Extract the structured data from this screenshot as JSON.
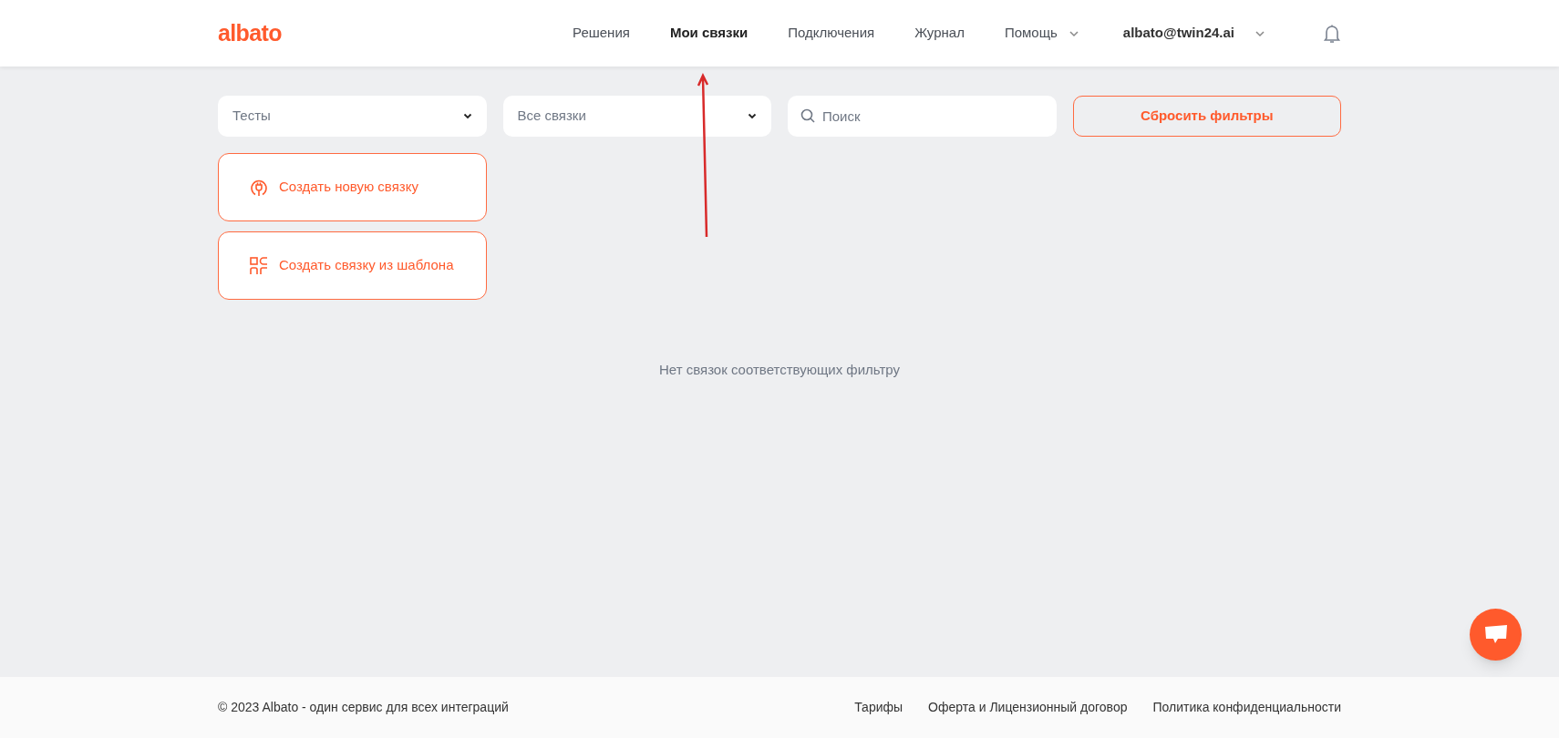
{
  "header": {
    "logo": "albato",
    "nav": [
      {
        "label": "Решения",
        "selected": false,
        "dropdown": false
      },
      {
        "label": "Мои связки",
        "selected": true,
        "dropdown": false
      },
      {
        "label": "Подключения",
        "selected": false,
        "dropdown": false
      },
      {
        "label": "Журнал",
        "selected": false,
        "dropdown": false
      },
      {
        "label": "Помощь",
        "selected": false,
        "dropdown": true
      }
    ],
    "account": "albato@twin24.ai"
  },
  "filters": [
    {
      "kind": "select",
      "value": "Тесты"
    },
    {
      "kind": "select",
      "value": "Все связки"
    },
    {
      "kind": "search",
      "placeholder": "Поиск"
    },
    {
      "kind": "reset",
      "label": "Сбросить фильтры"
    }
  ],
  "actions": [
    {
      "kind": "new",
      "label": "Создать новую связку"
    },
    {
      "kind": "template",
      "label": "Создать связку из шаблона"
    }
  ],
  "empty_message": "Нет связок соответствующих фильтру",
  "footer": {
    "copyright": "© 2023 Albato - один сервис для всех интеграций",
    "links": [
      "Тарифы",
      "Оферта и Лицензионный договор",
      "Политика конфиденциальности"
    ]
  }
}
